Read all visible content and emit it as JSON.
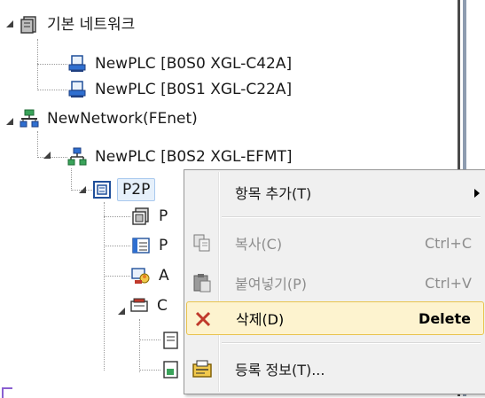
{
  "tree": {
    "basic_network": "기본 네트워크",
    "plc_c42a": "NewPLC [B0S0 XGL-C42A]",
    "plc_c22a": "NewPLC [B0S1 XGL-C22A]",
    "new_network": "NewNetwork(FEnet)",
    "plc_efmt": "NewPLC [B0S2 XGL-EFMT]",
    "p2p": "P2P",
    "child_a": "P",
    "child_b": "P",
    "child_c": "A",
    "child_d": "C"
  },
  "context_menu": {
    "add_item": "항목 추가(T)",
    "copy": "복사(C)",
    "copy_shortcut": "Ctrl+C",
    "paste": "붙여넣기(P)",
    "paste_shortcut": "Ctrl+V",
    "delete": "삭제(D)",
    "delete_shortcut": "Delete",
    "register_info": "등록 정보(T)..."
  },
  "colors": {
    "highlight_bg": "#fdf3cf",
    "highlight_border": "#e8c34e",
    "selection_bg": "#e6f0fb",
    "delete_icon": "#c0392b"
  }
}
